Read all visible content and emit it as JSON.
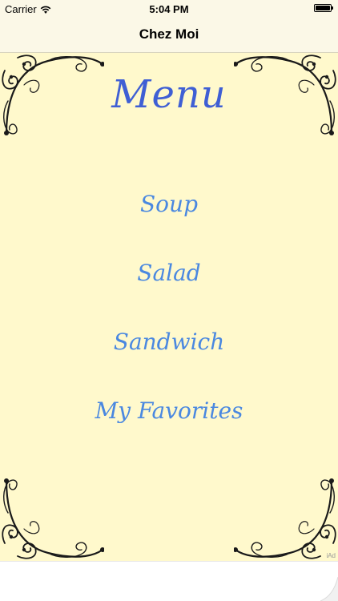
{
  "status_bar": {
    "carrier": "Carrier",
    "time": "5:04 PM",
    "battery_level": 1.0
  },
  "nav": {
    "title": "Chez Moi"
  },
  "menu": {
    "title": "Menu",
    "items": [
      {
        "label": "Soup"
      },
      {
        "label": "Salad"
      },
      {
        "label": "Sandwich"
      },
      {
        "label": "My Favorites"
      }
    ]
  },
  "ad": {
    "label": "iAd"
  },
  "colors": {
    "background": "#fff9cc",
    "bar_background": "#fbf8e7",
    "title_color": "#3f5fd4",
    "item_color": "#4a88e0",
    "ornament_color": "#1a1a1a"
  },
  "icons": {
    "wifi": "wifi-icon",
    "battery": "battery-icon",
    "corner": "flourish-ornament-icon"
  }
}
